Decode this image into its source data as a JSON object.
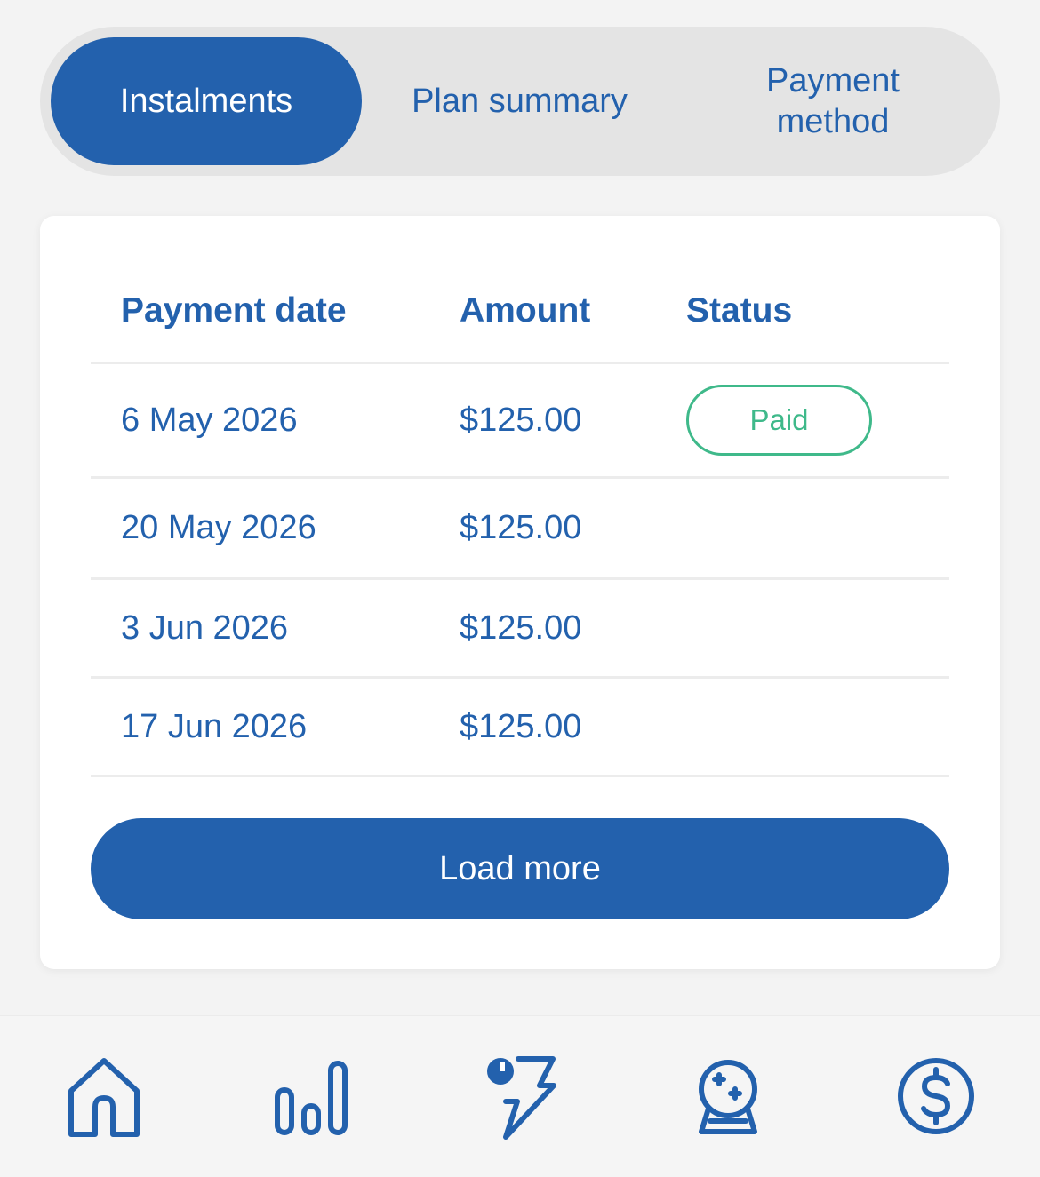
{
  "tabs": {
    "instalments": "Instalments",
    "plan_summary": "Plan summary",
    "payment_method": "Payment method"
  },
  "table": {
    "headers": {
      "date": "Payment date",
      "amount": "Amount",
      "status": "Status"
    },
    "rows": [
      {
        "date": "6 May 2026",
        "amount": "$125.00",
        "status": "Paid"
      },
      {
        "date": "20 May 2026",
        "amount": "$125.00",
        "status": ""
      },
      {
        "date": "3 Jun 2026",
        "amount": "$125.00",
        "status": ""
      },
      {
        "date": "17 Jun 2026",
        "amount": "$125.00",
        "status": ""
      }
    ]
  },
  "load_more_label": "Load more",
  "nav": {
    "items": [
      {
        "icon": "home-icon"
      },
      {
        "icon": "bar-chart-icon"
      },
      {
        "icon": "lightning-icon"
      },
      {
        "icon": "crystal-ball-icon"
      },
      {
        "icon": "dollar-coin-icon"
      }
    ]
  },
  "colors": {
    "brand": "#2361ad",
    "paid": "#3fb98a",
    "background": "#f3f3f3",
    "tab_track": "#e4e4e4"
  }
}
